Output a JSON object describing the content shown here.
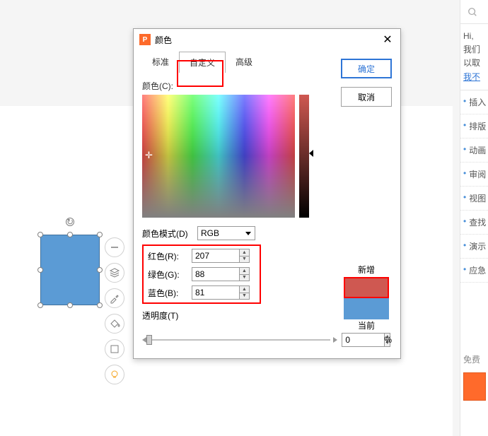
{
  "dialog": {
    "title": "颜色",
    "tabs": {
      "standard": "标准",
      "custom": "自定义",
      "advanced": "高级"
    },
    "ok": "确定",
    "cancel": "取消",
    "color_label": "颜色(C):",
    "mode_label": "颜色模式(D)",
    "mode_value": "RGB",
    "red_label": "红色(R):",
    "green_label": "绿色(G):",
    "blue_label": "蓝色(B):",
    "red_val": "207",
    "green_val": "88",
    "blue_val": "81",
    "alpha_label": "透明度(T)",
    "alpha_val": "0",
    "pct": "%",
    "new_label": "新增",
    "current_label": "当前"
  },
  "side": {
    "hi1": "Hi,",
    "hi2": "我们",
    "hi3": "以取",
    "hi4": "我不",
    "items": [
      "插入",
      "排版",
      "动画",
      "审阅",
      "视图",
      "查找",
      "演示",
      "应急"
    ],
    "foot": "免费"
  }
}
